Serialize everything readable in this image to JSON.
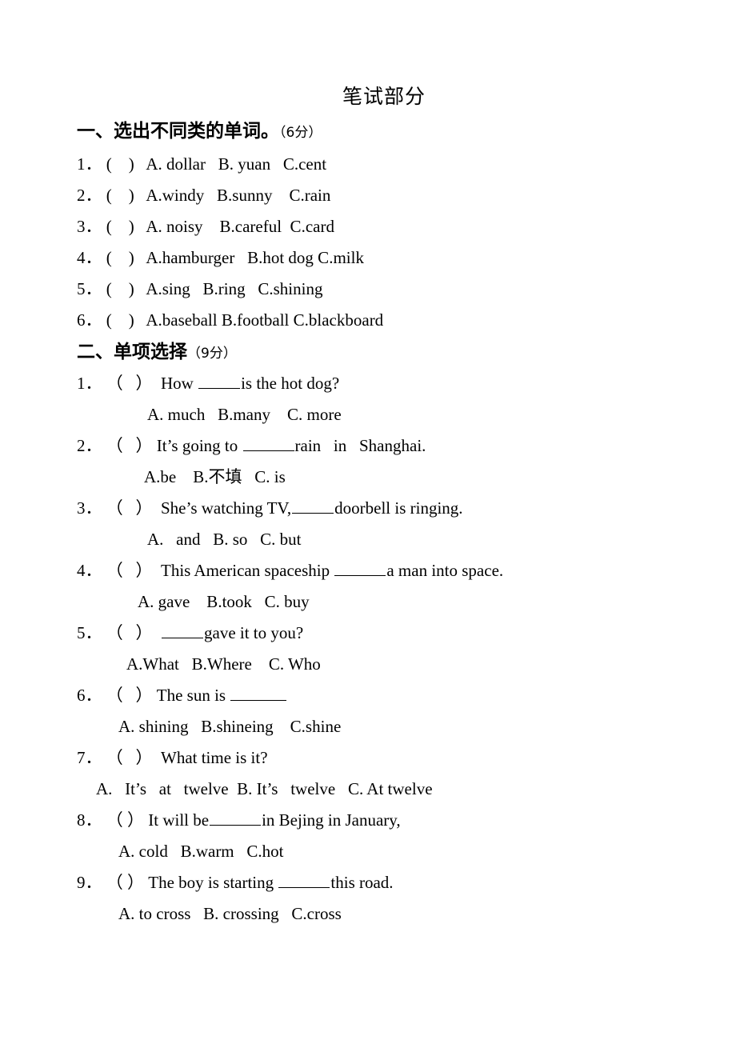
{
  "document": {
    "title": "笔试部分"
  },
  "sections": [
    {
      "id": "section-1",
      "number": "一、",
      "heading": "选出不同类的单词。",
      "points": "（6分）",
      "questions": [
        {
          "num": "1．",
          "bracket": "(    )",
          "text": "A. dollar   B. yuan   C.cent"
        },
        {
          "num": "2．",
          "bracket": "(    )",
          "text": "A.windy   B.sunny    C.rain"
        },
        {
          "num": "3．",
          "bracket": "(    )",
          "text": "A. noisy    B.careful  C.card"
        },
        {
          "num": "4．",
          "bracket": "(    )",
          "text": "A.hamburger   B.hot dog C.milk"
        },
        {
          "num": "5．",
          "bracket": "(    )",
          "text": "A.sing   B.ring   C.shining"
        },
        {
          "num": "6．",
          "bracket": "(    )",
          "text": "A.baseball B.football C.blackboard"
        }
      ]
    },
    {
      "id": "section-2",
      "number": "二、",
      "heading": "单项选择",
      "points": "（9分）",
      "questions": [
        {
          "num": "1．",
          "bracket": "（   ）",
          "stem_before": "  How ",
          "blank": "b5",
          "stem_after": "is the hot dog?",
          "options": "A. much   B.many    C. more"
        },
        {
          "num": "2．",
          "bracket": "（   ）",
          "stem_before": " It’s going to ",
          "blank": "b6",
          "stem_after": "rain   in   Shanghai.",
          "options": "A.be    B.不填   C. is"
        },
        {
          "num": "3．",
          "bracket": "（   ）",
          "stem_before": "  She’s watching TV,",
          "blank": "b5",
          "stem_after": "doorbell is ringing.",
          "options": "A.   and   B. so   C. but"
        },
        {
          "num": "4．",
          "bracket": "（   ）",
          "stem_before": "  This American spaceship ",
          "blank": "b6",
          "stem_after": "a man into space.",
          "options": "A. gave    B.took   C. buy"
        },
        {
          "num": "5．",
          "bracket": "（   ）",
          "stem_before": "  ",
          "blank": "b5",
          "stem_after": "gave it to you?",
          "options": "A.What   B.Where    C. Who"
        },
        {
          "num": "6．",
          "bracket": "（   ）",
          "stem_before": " The sun is ",
          "blank": "b6",
          "stem_after": "",
          "options": "A. shining   B.shineing    C.shine"
        },
        {
          "num": "7．",
          "bracket": "（   ）",
          "stem_before": "  What time is it?",
          "blank": "",
          "stem_after": "",
          "options": "A.   It’s   at   twelve  B. It’s   twelve   C. At twelve"
        },
        {
          "num": "8．",
          "bracket": "（ ）",
          "stem_before": " It will be",
          "blank": "b6",
          "stem_after": "in Bejing in January,",
          "options": "A. cold   B.warm   C.hot"
        },
        {
          "num": "9．",
          "bracket": "（ ）",
          "stem_before": " The boy is starting ",
          "blank": "b6",
          "stem_after": "this road.",
          "options": "A. to cross   B. crossing   C.cross"
        }
      ]
    }
  ]
}
